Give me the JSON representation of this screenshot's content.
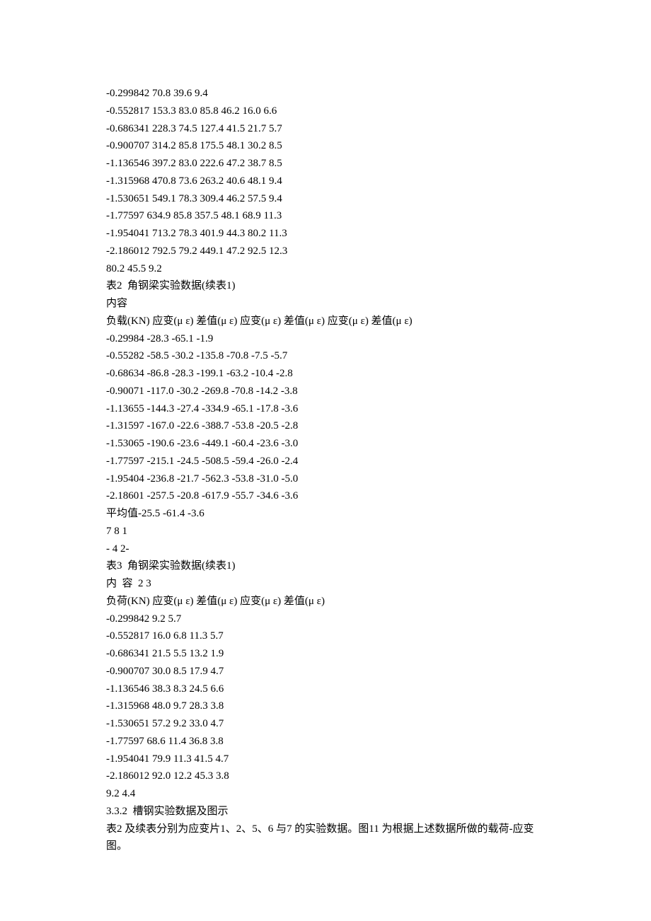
{
  "lines": [
    "-0.299842 70.8 39.6 9.4",
    "-0.552817 153.3 83.0 85.8 46.2 16.0 6.6",
    "-0.686341 228.3 74.5 127.4 41.5 21.7 5.7",
    "-0.900707 314.2 85.8 175.5 48.1 30.2 8.5",
    "-1.136546 397.2 83.0 222.6 47.2 38.7 8.5",
    "-1.315968 470.8 73.6 263.2 40.6 48.1 9.4",
    "-1.530651 549.1 78.3 309.4 46.2 57.5 9.4",
    "-1.77597 634.9 85.8 357.5 48.1 68.9 11.3",
    "-1.954041 713.2 78.3 401.9 44.3 80.2 11.3",
    "-2.186012 792.5 79.2 449.1 47.2 92.5 12.3",
    "80.2 45.5 9.2",
    "表2  角钢梁实验数据(续表1)",
    "内容",
    "负载(KN) 应变(μ ε) 差值(μ ε) 应变(μ ε) 差值(μ ε) 应变(μ ε) 差值(μ ε)",
    "-0.29984 -28.3 -65.1 -1.9",
    "-0.55282 -58.5 -30.2 -135.8 -70.8 -7.5 -5.7",
    "-0.68634 -86.8 -28.3 -199.1 -63.2 -10.4 -2.8",
    "-0.90071 -117.0 -30.2 -269.8 -70.8 -14.2 -3.8",
    "-1.13655 -144.3 -27.4 -334.9 -65.1 -17.8 -3.6",
    "-1.31597 -167.0 -22.6 -388.7 -53.8 -20.5 -2.8",
    "-1.53065 -190.6 -23.6 -449.1 -60.4 -23.6 -3.0",
    "-1.77597 -215.1 -24.5 -508.5 -59.4 -26.0 -2.4",
    "-1.95404 -236.8 -21.7 -562.3 -53.8 -31.0 -5.0",
    "-2.18601 -257.5 -20.8 -617.9 -55.7 -34.6 -3.6",
    "平均值-25.5 -61.4 -3.6",
    "7 8 1",
    "- 4 2-",
    "表3  角钢梁实验数据(续表1)",
    "内  容  2 3",
    "负荷(KN) 应变(μ ε) 差值(μ ε) 应变(μ ε) 差值(μ ε)",
    "-0.299842 9.2 5.7",
    "-0.552817 16.0 6.8 11.3 5.7",
    "-0.686341 21.5 5.5 13.2 1.9",
    "-0.900707 30.0 8.5 17.9 4.7",
    "-1.136546 38.3 8.3 24.5 6.6",
    "-1.315968 48.0 9.7 28.3 3.8",
    "-1.530651 57.2 9.2 33.0 4.7",
    "-1.77597 68.6 11.4 36.8 3.8",
    "-1.954041 79.9 11.3 41.5 4.7",
    "-2.186012 92.0 12.2 45.3 3.8",
    "9.2 4.4",
    "3.3.2  槽钢实验数据及图示",
    "表2 及续表分别为应变片1、2、5、6 与7 的实验数据。图11 为根据上述数据所做的载荷-应变图。"
  ]
}
